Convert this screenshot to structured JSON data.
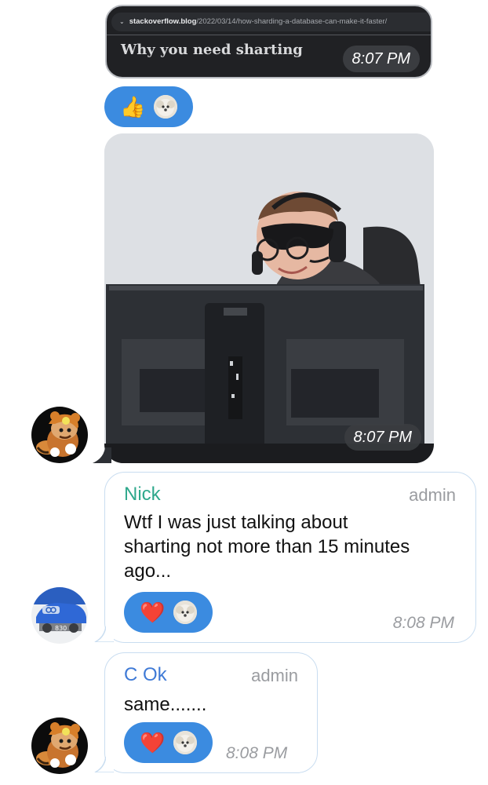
{
  "link_preview": {
    "url_host": "stackoverflow.blog",
    "url_path": "/2022/03/14/how-sharding-a-database-can-make-it-faster/",
    "title": "Why you need sharting",
    "time": "8:07 PM"
  },
  "reaction_1": {
    "emoji": "👍",
    "reactor": "dog-avatar"
  },
  "photo_message": {
    "time": "8:07 PM"
  },
  "message_nick": {
    "sender": "Nick",
    "sender_color": "#2fa88c",
    "role": "admin",
    "text_lines": [
      "Wtf I was just talking about",
      "sharting not more than 15 minutes",
      "ago..."
    ],
    "reaction_emoji": "❤️",
    "time": "8:08 PM"
  },
  "message_cok": {
    "sender": "C Ok",
    "sender_color": "#3f7ad6",
    "role": "admin",
    "text": "same.......",
    "reaction_emoji": "❤️",
    "time": "8:08 PM"
  },
  "colors": {
    "reaction_bg": "#3b8be0",
    "bubble_border": "#c9ddf0",
    "meta_text": "#9a9ca0"
  }
}
